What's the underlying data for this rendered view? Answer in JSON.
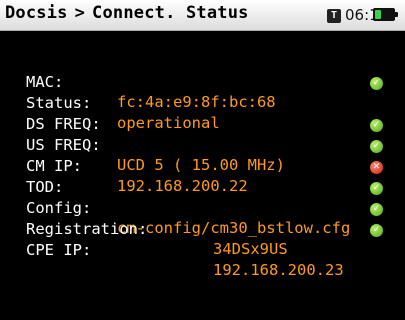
{
  "header": {
    "section": "Docsis",
    "separator": ">",
    "page": "Connect. Status",
    "sys_icon": "T",
    "time": "06:18",
    "battery_level": 0.35,
    "battery_color": "#3fd34a"
  },
  "colors": {
    "background": "#000000",
    "label": "#ffffff",
    "value": "#ff9a1f",
    "ok": "#4fa818",
    "error": "#d41a12"
  },
  "fields": [
    {
      "label": "MAC:",
      "value": "fc:4a:e9:8f:bc:68",
      "status": "none"
    },
    {
      "label": "Status:",
      "value": "operational",
      "status": "ok"
    },
    {
      "label": "DS FREQ:",
      "value": "",
      "status": "none"
    },
    {
      "label": "US FREQ:",
      "value": "UCD 5 ( 15.00 MHz)",
      "status": "ok"
    },
    {
      "label": "CM IP:",
      "value": "192.168.200.22",
      "status": "ok"
    },
    {
      "label": "TOD:",
      "value": "",
      "status": "error"
    },
    {
      "label": "Config:",
      "value": "cm-config/cm30_bstlow.cfg",
      "status": "ok"
    },
    {
      "label": "Registration:",
      "value": "34DSx9US",
      "status": "ok"
    },
    {
      "label": "CPE IP:",
      "value": "192.168.200.23",
      "status": "ok"
    }
  ],
  "status_icons": {
    "ok": "check-circle-icon",
    "error": "x-circle-icon"
  },
  "status_glyphs": {
    "ok": "✓",
    "error": "✕"
  }
}
